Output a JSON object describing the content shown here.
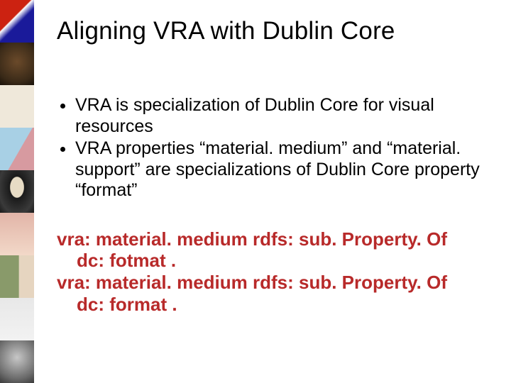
{
  "title": "Aligning VRA with Dublin Core",
  "bullets": [
    "VRA is specialization of Dublin Core for visual resources",
    "VRA properties “material. medium” and “material. support” are specializations of Dublin Core property “format”"
  ],
  "code": {
    "l1a": "vra: material. medium rdfs: sub. Property. Of",
    "l1b": "dc: fotmat .",
    "l2a": "vra: material. medium rdfs: sub. Property. Of",
    "l2b": "dc: format ."
  },
  "thumbs": [
    {
      "style": "background: linear-gradient(135deg,#c21 0%,#c21 40%,#fff 42%,#1a1a9a 55%,#1a1a9a 100%);"
    },
    {
      "style": "background: radial-gradient(circle at 50% 45%,#6b4a2a 0%,#3a2a18 70%,#1a120a 100%);"
    },
    {
      "style": "background: linear-gradient(#efe8da,#efe8da);"
    },
    {
      "style": "background: linear-gradient(120deg,#a8d0e5 0%,#a8d0e5 55%,#d79aa0 56%,#d79aa0 100%);"
    },
    {
      "style": "background: radial-gradient(ellipse at 50% 40%,#e7dcc5 0%,#e7dcc5 28%,#1a1a1a 30%,#3a3a3a 75%,#1a1a1a 100%);"
    },
    {
      "style": "background: linear-gradient(#e2b5a8,#f2d8c8);"
    },
    {
      "style": "background: linear-gradient(90deg,#899a6a 0%,#899a6a 55%,#e6d5c0 56%,#e6d5c0 100%);"
    },
    {
      "style": "background: linear-gradient(#e8e8e8,#f2f2f2);"
    },
    {
      "style": "background: radial-gradient(circle at 50% 40%,#c7c7c7 0%,#6a6a6a 70%,#3a3a3a 100%);"
    }
  ]
}
